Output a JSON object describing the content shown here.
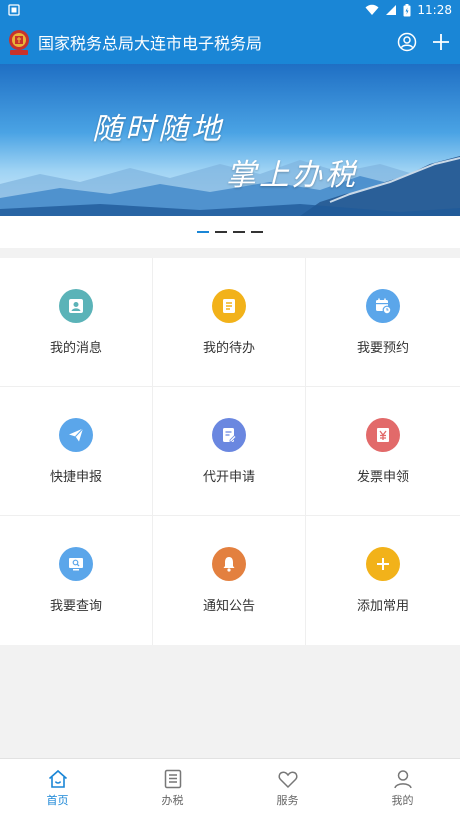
{
  "status_bar": {
    "time": "11:28"
  },
  "app_bar": {
    "title": "国家税务总局大连市电子税务局"
  },
  "banner": {
    "line1": "随时随地",
    "line2": "掌上办税"
  },
  "grid": {
    "items": [
      {
        "label": "我的消息",
        "icon": "user-icon",
        "color": "#5bb3b8"
      },
      {
        "label": "我的待办",
        "icon": "document-icon",
        "color": "#f2b21a"
      },
      {
        "label": "我要预约",
        "icon": "calendar-clock-icon",
        "color": "#5ba6ea"
      },
      {
        "label": "快捷申报",
        "icon": "paper-plane-icon",
        "color": "#5ba6ea"
      },
      {
        "label": "代开申请",
        "icon": "form-edit-icon",
        "color": "#6a87e0"
      },
      {
        "label": "发票申领",
        "icon": "invoice-icon",
        "color": "#e26a6a"
      },
      {
        "label": "我要查询",
        "icon": "monitor-search-icon",
        "color": "#5ba6ea"
      },
      {
        "label": "通知公告",
        "icon": "bell-icon",
        "color": "#e3803f"
      },
      {
        "label": "添加常用",
        "icon": "plus-icon",
        "color": "#f2b21a"
      }
    ]
  },
  "bottom_nav": {
    "items": [
      {
        "label": "首页",
        "active": true
      },
      {
        "label": "办税",
        "active": false
      },
      {
        "label": "服务",
        "active": false
      },
      {
        "label": "我的",
        "active": false
      }
    ]
  },
  "colors": {
    "primary": "#1a86d6"
  }
}
